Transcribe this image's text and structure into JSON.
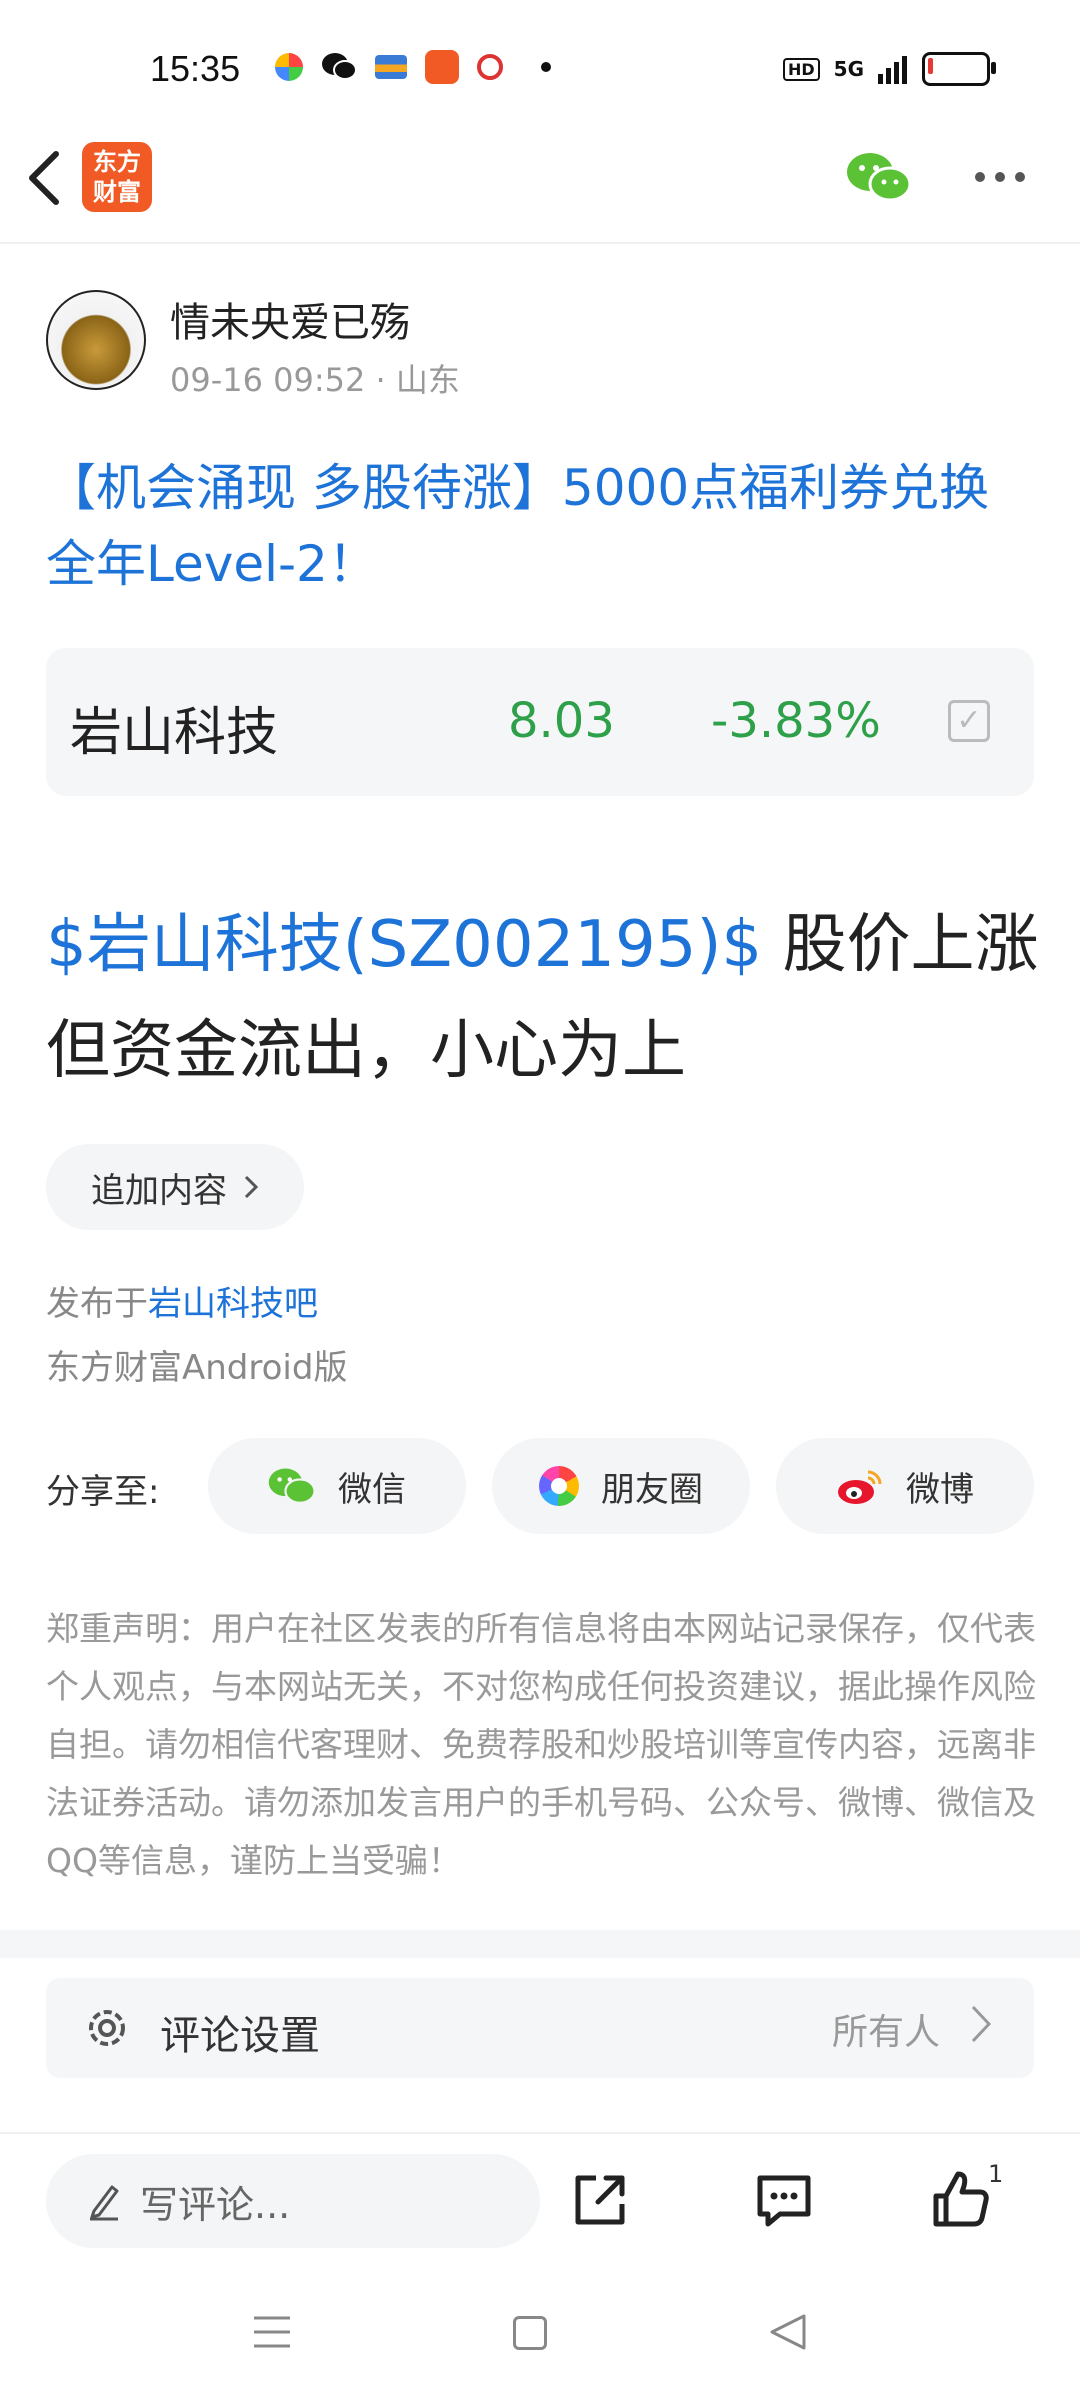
{
  "status_bar": {
    "time": "15:35",
    "network": "5G"
  },
  "header": {
    "logo_line1": "东方",
    "logo_line2": "财富"
  },
  "post": {
    "author": "情未央爱已殇",
    "meta": "09-16 09:52 · 山东",
    "title": "【机会涌现 多股待涨】5000点福利券兑换全年Level-2！",
    "stock": {
      "name": "岩山科技",
      "price": "8.03",
      "change": "-3.83%"
    },
    "content_tag": "$岩山科技(SZ002195)$",
    "content_text": " 股价上涨但资金流出，小心为上",
    "append_label": "追加内容",
    "posted_prefix": "发布于",
    "posted_forum": "岩山科技吧",
    "client": "东方财富Android版"
  },
  "share": {
    "label": "分享至:",
    "wechat": "微信",
    "moments": "朋友圈",
    "weibo": "微博"
  },
  "disclaimer": "郑重声明：用户在社区发表的所有信息将由本网站记录保存，仅代表个人观点，与本网站无关，不对您构成任何投资建议，据此操作风险自担。请勿相信代客理财、免费荐股和炒股培训等宣传内容，远离非法证券活动。请勿添加发言用户的手机号码、公众号、微博、微信及QQ等信息，谨防上当受骗！",
  "comment_settings": {
    "label": "评论设置",
    "value": "所有人"
  },
  "bottom_bar": {
    "comment_placeholder": "写评论...",
    "like_count": "1"
  },
  "colors": {
    "link_blue": "#1e73d8",
    "stock_green": "#2ea04a",
    "brand_orange": "#f15a24",
    "wechat_green": "#5bc236"
  }
}
